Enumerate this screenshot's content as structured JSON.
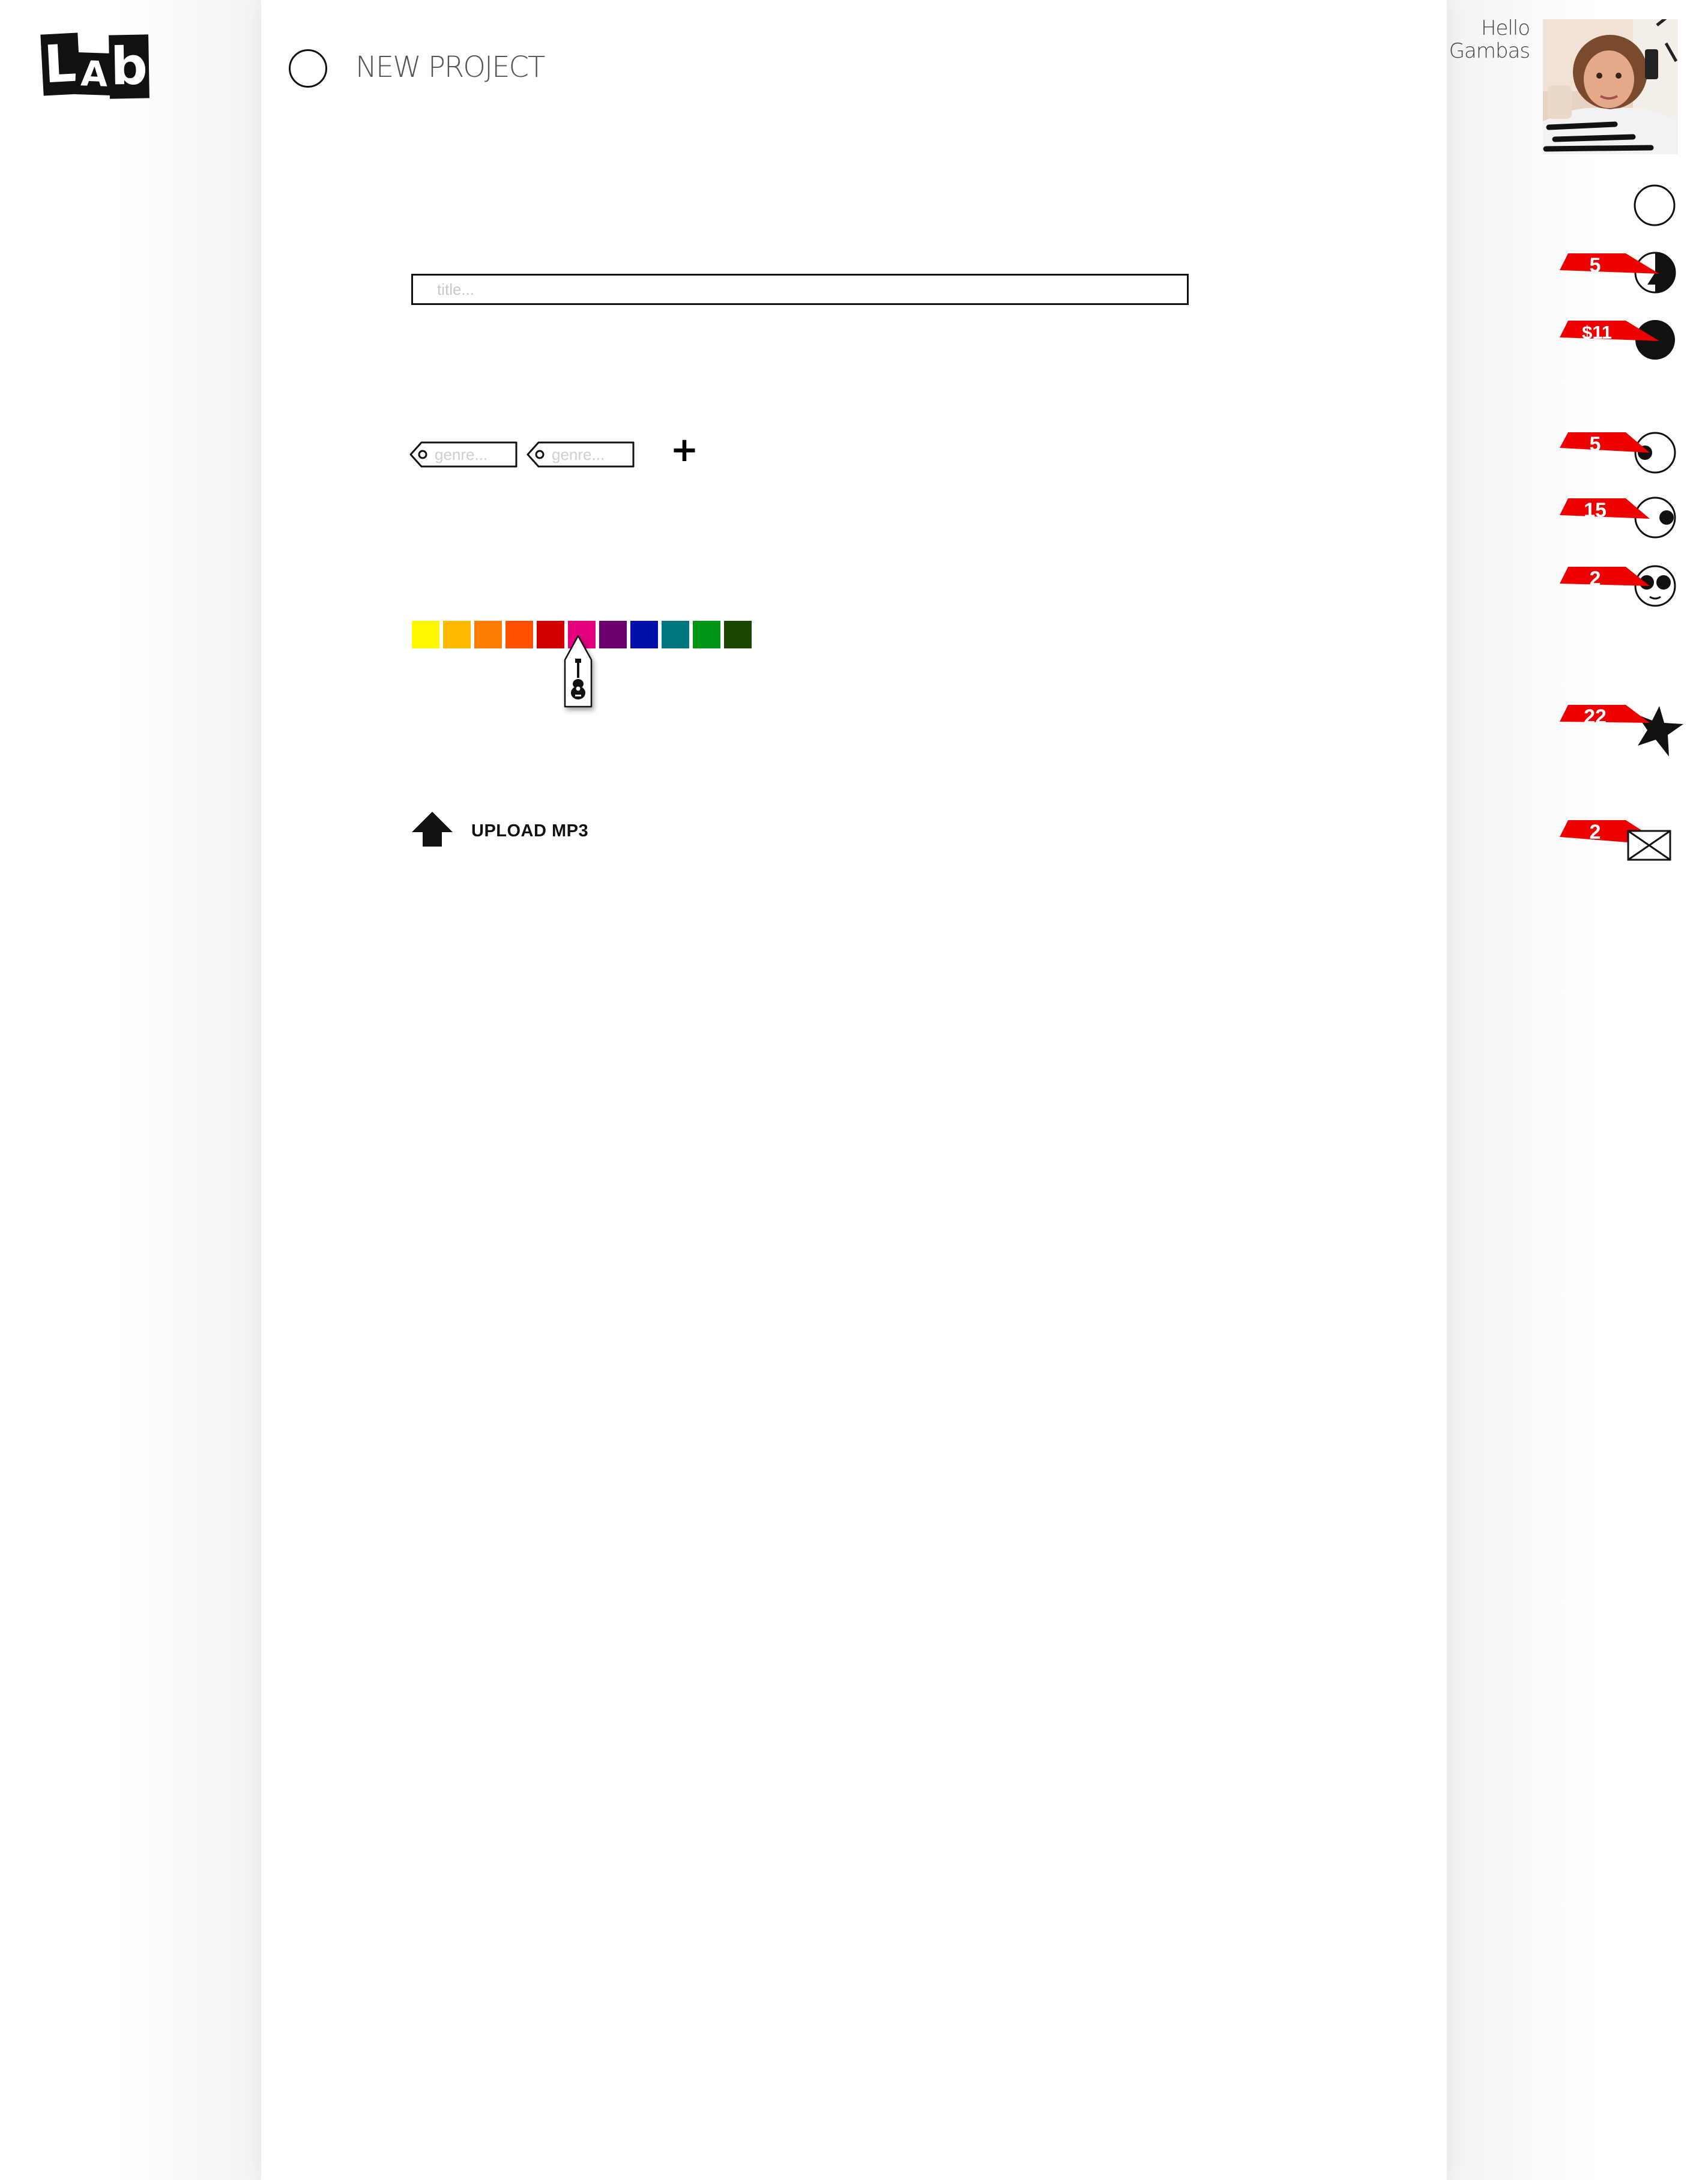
{
  "app": {
    "logo_letters": [
      "L",
      "A",
      "b"
    ]
  },
  "header": {
    "title": "NEW PROJECT"
  },
  "form": {
    "title_placeholder": "title...",
    "genre_placeholders": [
      "genre...",
      "genre..."
    ],
    "add_genre_label": "+",
    "colors": [
      "#fff600",
      "#ffba00",
      "#ff7d00",
      "#ff5000",
      "#d40000",
      "#e5007e",
      "#6b006f",
      "#0010a8",
      "#00767f",
      "#009415",
      "#1c4500"
    ],
    "selected_color_index": 5,
    "selected_color_icon": "guitar-icon",
    "upload_label": "UPLOAD MP3"
  },
  "user": {
    "greeting_line1": "Hello",
    "greeting_line2": "Gambas"
  },
  "status": [
    {
      "icon": "empty-circle-icon",
      "badge": ""
    },
    {
      "icon": "half-circle-icon",
      "badge": "5"
    },
    {
      "icon": "full-circle-icon",
      "badge": "$11"
    },
    {
      "icon": "dot-left-circle-icon",
      "badge": "5"
    },
    {
      "icon": "dot-right-circle-icon",
      "badge": "15"
    },
    {
      "icon": "face-icon",
      "badge": "2"
    },
    {
      "icon": "star-icon",
      "badge": "22"
    },
    {
      "icon": "envelope-icon",
      "badge": "2"
    }
  ],
  "colors": {
    "badge": "#ee0000",
    "ink": "#111111"
  }
}
